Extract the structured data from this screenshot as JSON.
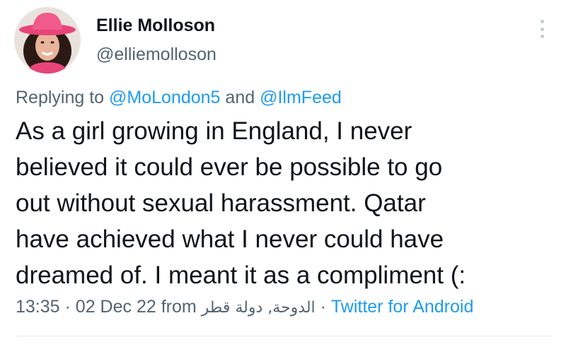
{
  "author": {
    "name": "Ellie Molloson",
    "handle": "@elliemolloson"
  },
  "reply": {
    "prefix": "Replying to",
    "mention_1": "@MoLondon5",
    "conjunction": "and",
    "mention_2": "@IlmFeed"
  },
  "tweet": {
    "lines": [
      "As a girl growing in England, I never",
      "believed it could ever be possible to go",
      "out without sexual harassment. Qatar",
      "have achieved what I never could have",
      "dreamed of. I meant it as a compliment (:"
    ]
  },
  "meta": {
    "time": "13:35",
    "date": "02 Dec 22",
    "from_label": "from",
    "location": "الدوحة, دولة قطر",
    "separator": "·",
    "source": "Twitter for Android"
  },
  "colors": {
    "text": "#0f1419",
    "secondary": "#536471",
    "link": "#1d9bf0",
    "avatar_hat": "#e8447a"
  },
  "icons": {
    "more": "more-vertical-icon"
  }
}
